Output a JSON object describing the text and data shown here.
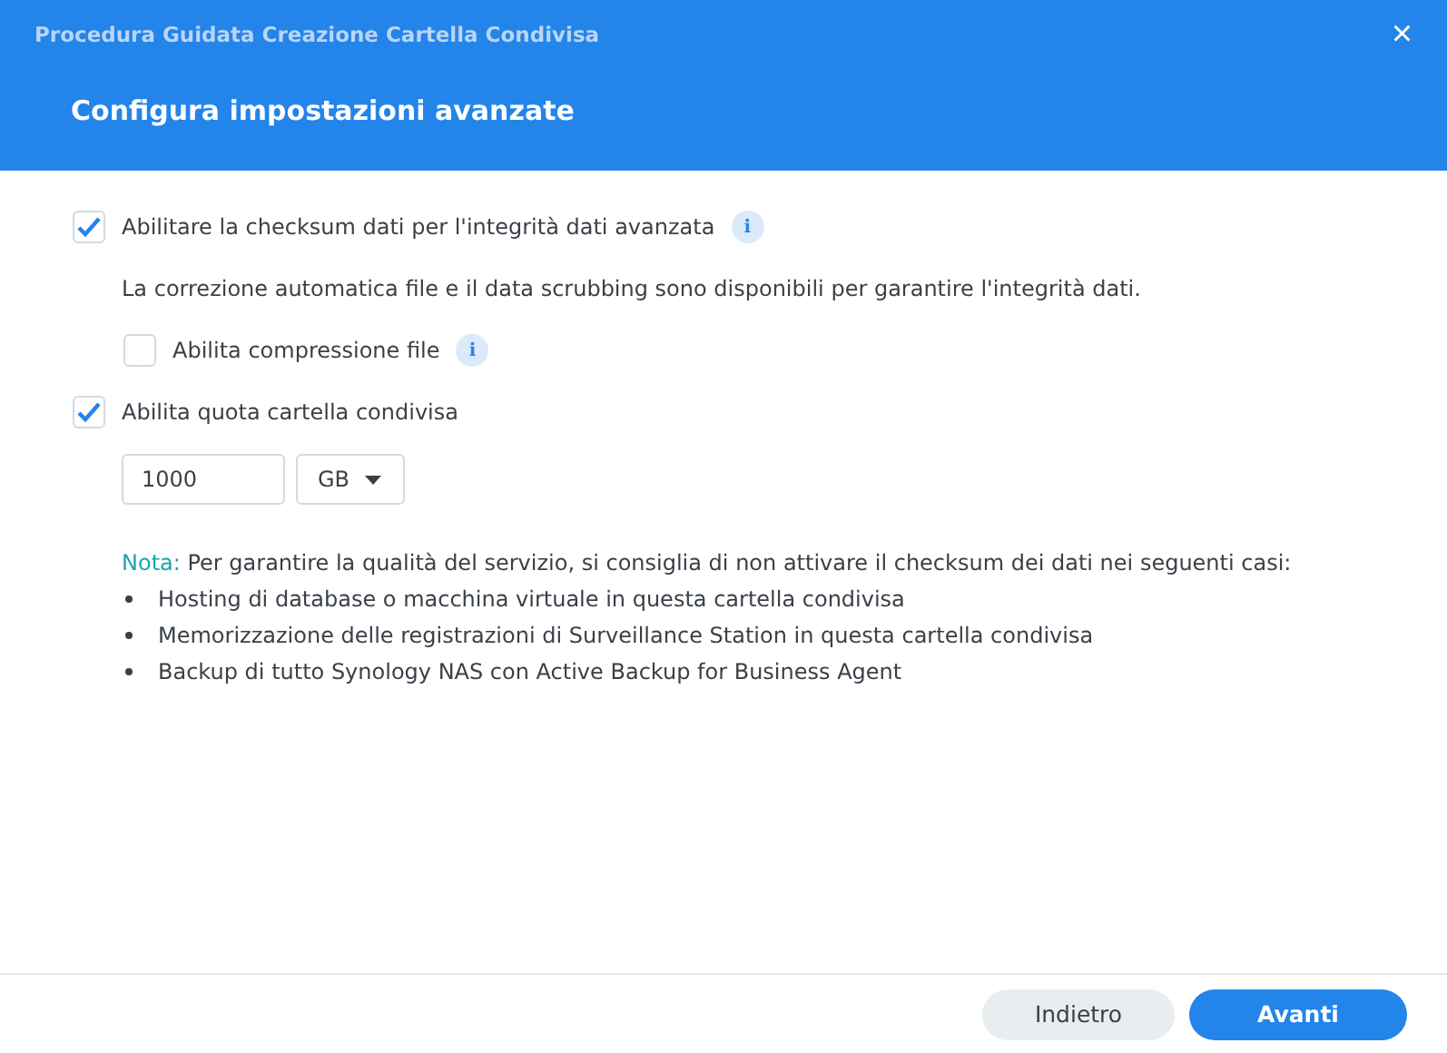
{
  "window": {
    "title": "Procedura Guidata Creazione Cartella Condivisa",
    "close": "×"
  },
  "header": {
    "subtitle": "Configura impostazioni avanzate"
  },
  "options": [
    {
      "kind": "checkbox",
      "label": "Abilitare la checksum dati per l'integrità dati avanzata",
      "checked": true,
      "info": "i",
      "indent": false
    },
    {
      "kind": "text",
      "text": "La correzione automatica file e il data scrubbing sono disponibili per garantire l'integrità dati."
    },
    {
      "kind": "checkbox",
      "label": "Abilita compressione file",
      "checked": false,
      "info": "i",
      "indent": true
    },
    {
      "kind": "checkbox",
      "label": "Abilita quota cartella condivisa",
      "checked": true,
      "indent": false
    },
    {
      "kind": "quota",
      "value": "1000",
      "unit": "GB"
    }
  ],
  "note": {
    "label": "Nota:",
    "text": " Per garantire la qualità del servizio, si consiglia di non attivare il checksum dei dati nei seguenti casi:",
    "items": [
      "Hosting di database o macchina virtuale in questa cartella condivisa",
      "Memorizzazione delle registrazioni di Surveillance Station in questa cartella condivisa",
      "Backup di tutto Synology NAS con Active Backup for Business Agent"
    ]
  },
  "buttons": [
    {
      "label": "Indietro",
      "kind": "secondary"
    },
    {
      "label": "Avanti",
      "kind": "primary"
    }
  ]
}
